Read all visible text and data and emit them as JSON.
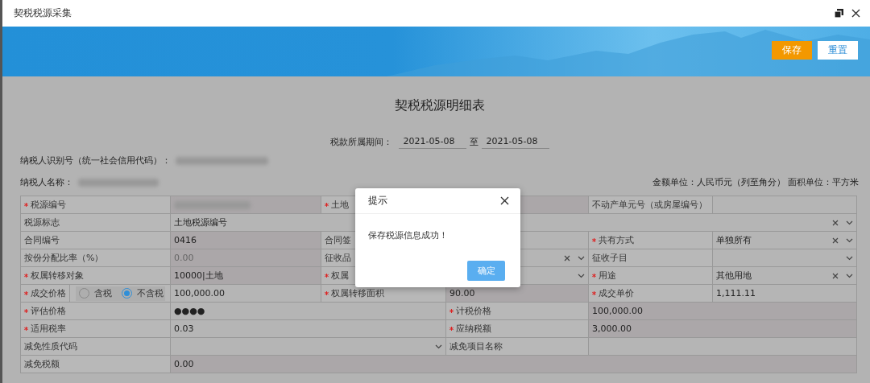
{
  "window": {
    "title": "契税税源采集"
  },
  "toolbar": {
    "buttons": [
      {
        "label": "保存",
        "kind": "primary"
      },
      {
        "label": "重置",
        "kind": "secondary"
      }
    ]
  },
  "form": {
    "title": "契税税源明细表",
    "period": {
      "label": "税款所属期间：",
      "start": "2021-05-08",
      "separator": "至",
      "end": "2021-05-08"
    },
    "taxpayer_id": {
      "label": "纳税人识别号（统一社会信用代码）：",
      "redacted": true
    },
    "taxpayer_name": {
      "label": "纳税人名称：",
      "redacted": true
    },
    "units": "金额单位：人民币元（列至角分） 面积单位：平方米",
    "rows": [
      {
        "kind": "six",
        "cells": [
          {
            "kind": "label",
            "text": "税源编号",
            "required": true
          },
          {
            "kind": "redacted",
            "readonly": true
          },
          {
            "kind": "label",
            "text": "土地",
            "required": true
          },
          {
            "kind": "value",
            "readonly": true
          },
          {
            "kind": "label",
            "text": "不动产单元号（或房屋编号）",
            "required": false
          },
          {
            "kind": "value",
            "readonly": false
          }
        ]
      },
      {
        "kind": "wide",
        "cells": [
          {
            "kind": "label",
            "text": "税源标志",
            "required": false
          },
          {
            "kind": "select",
            "text": "土地税源编号",
            "clearable": true
          }
        ]
      },
      {
        "kind": "six",
        "cells": [
          {
            "kind": "label",
            "text": "合同编号",
            "required": false
          },
          {
            "kind": "value",
            "text": "0416",
            "readonly": true,
            "disabled": false
          },
          {
            "kind": "label",
            "text": "合同签",
            "required": false
          },
          {
            "kind": "value",
            "readonly": false
          },
          {
            "kind": "label",
            "text": "共有方式",
            "required": true
          },
          {
            "kind": "select",
            "text": "单独所有",
            "clearable": true
          }
        ]
      },
      {
        "kind": "six",
        "cells": [
          {
            "kind": "label",
            "text": "按份分配比率（%）",
            "required": false
          },
          {
            "kind": "value",
            "text": "0.00",
            "readonly": true,
            "disabled": true
          },
          {
            "kind": "label",
            "text": "征收品",
            "required": false
          },
          {
            "kind": "select",
            "clearable": true
          },
          {
            "kind": "label",
            "text": "征收子目",
            "required": false
          },
          {
            "kind": "select",
            "clearable": false
          }
        ]
      },
      {
        "kind": "six",
        "cells": [
          {
            "kind": "label",
            "text": "权属转移对象",
            "required": true
          },
          {
            "kind": "value",
            "text": "10000|土地",
            "readonly": true,
            "disabled": false
          },
          {
            "kind": "label",
            "text": "权属",
            "required": true
          },
          {
            "kind": "select",
            "clearable": false
          },
          {
            "kind": "label",
            "text": "用途",
            "required": true
          },
          {
            "kind": "select",
            "text": "其他用地",
            "clearable": true
          }
        ]
      },
      {
        "kind": "six",
        "cells": [
          {
            "kind": "label-radio",
            "text": "成交价格",
            "required": true,
            "options": [
              {
                "label": "含税",
                "selected": false
              },
              {
                "label": "不含税",
                "selected": true
              }
            ]
          },
          {
            "kind": "value",
            "text": "100,000.00",
            "readonly": false,
            "disabled": false
          },
          {
            "kind": "label",
            "text": "权属转移面积",
            "required": true
          },
          {
            "kind": "value",
            "text": "90.00",
            "readonly": true,
            "disabled": false
          },
          {
            "kind": "label",
            "text": "成交单价",
            "required": true
          },
          {
            "kind": "value",
            "text": "1,111.11",
            "readonly": false,
            "disabled": false
          }
        ]
      },
      {
        "kind": "split",
        "cells": [
          {
            "kind": "label",
            "text": "评估价格",
            "required": true
          },
          {
            "kind": "value",
            "text": "●●●●",
            "readonly": false,
            "disabled": false
          },
          {
            "kind": "label",
            "text": "计税价格",
            "required": true
          },
          {
            "kind": "value",
            "text": "100,000.00",
            "readonly": true,
            "disabled": false
          }
        ]
      },
      {
        "kind": "split",
        "cells": [
          {
            "kind": "label",
            "text": "适用税率",
            "required": true
          },
          {
            "kind": "value",
            "text": "0.03",
            "readonly": false,
            "disabled": false
          },
          {
            "kind": "label",
            "text": "应纳税额",
            "required": true
          },
          {
            "kind": "value",
            "text": "3,000.00",
            "readonly": true,
            "disabled": false
          }
        ]
      },
      {
        "kind": "split",
        "cells": [
          {
            "kind": "label",
            "text": "减免性质代码",
            "required": false
          },
          {
            "kind": "select",
            "clearable": false
          },
          {
            "kind": "label",
            "text": "减免项目名称",
            "required": false
          },
          {
            "kind": "value",
            "readonly": false
          }
        ]
      },
      {
        "kind": "wide",
        "cells": [
          {
            "kind": "label",
            "text": "减免税额",
            "required": false
          },
          {
            "kind": "value",
            "text": "0.00",
            "readonly": true,
            "disabled": false
          }
        ]
      }
    ]
  },
  "dialog": {
    "title": "提示",
    "message": "保存税源信息成功！",
    "button": "确定"
  }
}
